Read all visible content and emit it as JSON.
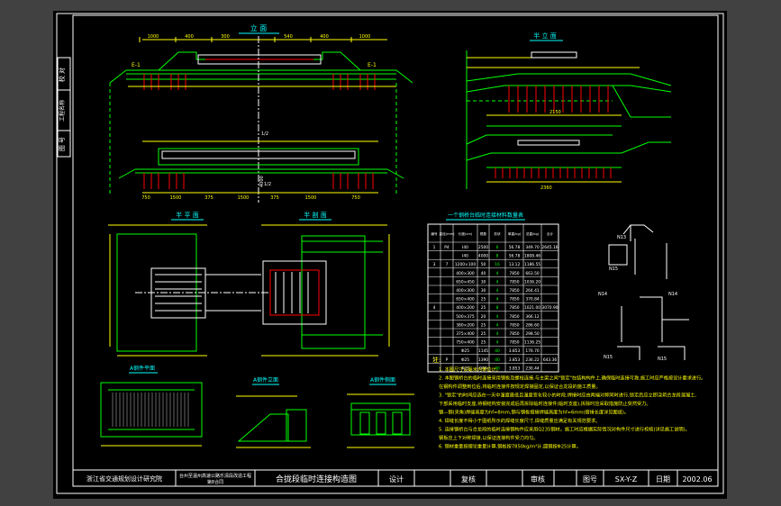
{
  "colors": {
    "background": "#414141",
    "paper": "#000000",
    "frame": "#ffffff",
    "geometry": "#00ff00",
    "dims": "#ffff00",
    "titles": "#00ffff",
    "rebar": "#ff0000",
    "table": "#ffffff"
  },
  "views": {
    "elevation": "立 面",
    "half_elevation": "半 立 面",
    "half_plan": "半 平 面",
    "half_section": "半 剖 面",
    "rebar_plan": "A钢件平面",
    "rebar_elevation": "A钢件立面",
    "rebar_side": "A钢件侧面"
  },
  "side_strip": [
    "校 对",
    "工程名称",
    "图 号"
  ],
  "elevation_labels": {
    "left_mark": "E-1",
    "right_mark": "E-1",
    "center_top": "1/2",
    "center_mid": "4000",
    "center_bottom": "1/2",
    "dims_top": [
      "1000",
      "400",
      "300",
      "540",
      "400",
      "1000"
    ],
    "dims_bottom": [
      "750",
      "1500",
      "375",
      "1500",
      "375",
      "1500",
      "750"
    ]
  },
  "table": {
    "title": "一个钢桥台临时连接材料数量表",
    "headers": [
      "编号",
      "直径(mm)",
      "长度(cm)",
      "根数",
      "形状",
      "单重(kg)",
      "总重(kg)",
      "合计"
    ],
    "rows": [
      [
        "1",
        "P4",
        "I40",
        "2500",
        "6",
        "56.78",
        "349.70",
        "2645.16"
      ],
      [
        "",
        "",
        "I40",
        "4000",
        "8",
        "56.78",
        "1808.46",
        ""
      ],
      [
        "3",
        "7",
        "1200×100",
        "50",
        "16",
        "13.12",
        "1186.55",
        ""
      ],
      [
        "",
        "",
        "400×300",
        "40",
        "4",
        "7850",
        "663.50",
        ""
      ],
      [
        "",
        "",
        "650×450",
        "30",
        "4",
        "7850",
        "1036.20",
        ""
      ],
      [
        "",
        "",
        "400×300",
        "30",
        "4",
        "7850",
        "264.41",
        ""
      ],
      [
        "",
        "",
        "650×400",
        "25",
        "4",
        "7850",
        "370.84",
        ""
      ],
      [
        "4",
        "",
        "400×200",
        "25",
        "8",
        "7850",
        "1021.00",
        "3070.90"
      ],
      [
        "",
        "",
        "500×375",
        "20",
        "4",
        "7850",
        "366.12",
        ""
      ],
      [
        "",
        "",
        "380×200",
        "25",
        "4",
        "7850",
        "286.60",
        ""
      ],
      [
        "",
        "",
        "375×400",
        "25",
        "4",
        "7850",
        "298.50",
        ""
      ],
      [
        "",
        "",
        "750×400",
        "25",
        "4",
        "7850",
        "1136.25",
        ""
      ],
      [
        "",
        "",
        "Φ25",
        "1145",
        "40",
        "3.853",
        "176.70",
        ""
      ],
      [
        "5",
        "P",
        "Φ25",
        "1390",
        "40",
        "3.853",
        "236.22",
        "643.36"
      ],
      [
        "",
        "",
        "Φ25",
        "900",
        "40",
        "3.853",
        "230.44",
        ""
      ]
    ]
  },
  "notes": {
    "title": "注:",
    "items": [
      "1. 本图尺寸以毫米为单位计。",
      "2. 本图钢桥台的临时连接采用钢板及螺栓连接,与主梁之间\"锁定\"在结构构件上,确保临时连接可靠,施工时应严格按设计要求进行。",
      "   在钢构件调整到位后,将临时连接件按规定焊接固定,以保证合龙段的施工质量。",
      "3. \"锁定\"的时间应选在一天中温度最低且温度变化较小的时段,焊接时应由两端对称同时进行,锁定后应立即浇筑合龙段混凝土,",
      "   下部采用临时支座,待钢结构安装完成后再拆除临时连接件(临时支座),拆除时应采取措施防止突然受力。",
      "   钢—钢(夹角)焊缝高度为hf=8mm,钢与钢板搭接焊缝高度为hf=6mm(搭接长度详见图纸)。",
      "4. 焊缝长度不得小于图纸所示的焊缝长度尺寸,焊缝质量应满足有关规范要求。",
      "5. 连接钢桥台与合龙段的临时连接钢构件应采用Q235钢材。施工时应根据实际情况对构件尺寸进行校核(详见施工说明)。",
      "   钢板应上下对称焊接,以保证连接构件受力均匀。",
      "6. 钢材重量按理论重量计算,钢板按7850kg/m³计,圆钢按Φ25计算。"
    ]
  },
  "rebar_labels": [
    "N13",
    "N15",
    "N14",
    "N14",
    "N15",
    "N15"
  ],
  "title_block": {
    "institute": "浙江省交通规划设计研究院",
    "project_line1": "台州至温州高速公路乐清段改造工程",
    "project_line2": "第8合同",
    "drawing_title": "合拢段临时连接构造图",
    "design_label": "设计",
    "review_label": "复核",
    "check_label": "审核",
    "drawing_no_label": "图号",
    "drawing_no": "SX-Y-Z",
    "date_label": "日期",
    "date": "2002.06"
  }
}
